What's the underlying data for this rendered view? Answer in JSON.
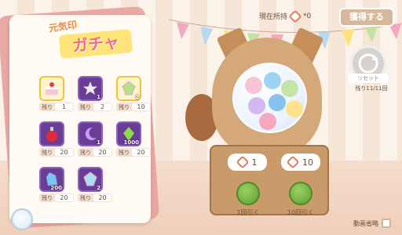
{
  "card": {
    "title_small": "元気印",
    "title_big": "ガチャ",
    "remain_label": "残り",
    "items": [
      {
        "icon": "cake-icon",
        "count": "",
        "remaining": "1"
      },
      {
        "icon": "star-icon",
        "count": "1",
        "remaining": "2"
      },
      {
        "icon": "gem-icon",
        "count": "2",
        "remaining": "10"
      },
      {
        "icon": "potion-icon",
        "count": "",
        "remaining": "20"
      },
      {
        "icon": "moon-icon",
        "count": "1",
        "remaining": "20"
      },
      {
        "icon": "green-crystal-icon",
        "count": "1000",
        "remaining": "20"
      },
      {
        "icon": "blue-crystal-icon",
        "count": "200",
        "remaining": "20"
      },
      {
        "icon": "rainbow-gem-icon",
        "count": "2",
        "remaining": "20"
      }
    ]
  },
  "header": {
    "possession_label": "現在所持",
    "possession_value": "*0",
    "acquire_label": "獲得する"
  },
  "reset": {
    "label": "リセット",
    "remaining": "残り11/11回"
  },
  "machine": {
    "bubble_one": "1",
    "bubble_ten": "10",
    "pull_one_label": "1回引く",
    "pull_ten_label": "10回引く"
  },
  "footer": {
    "skip_video_label": "動画省略"
  },
  "colors": {
    "accent": "#f36a8d",
    "button": "#d7b89b",
    "lever": "#6fae3c"
  }
}
